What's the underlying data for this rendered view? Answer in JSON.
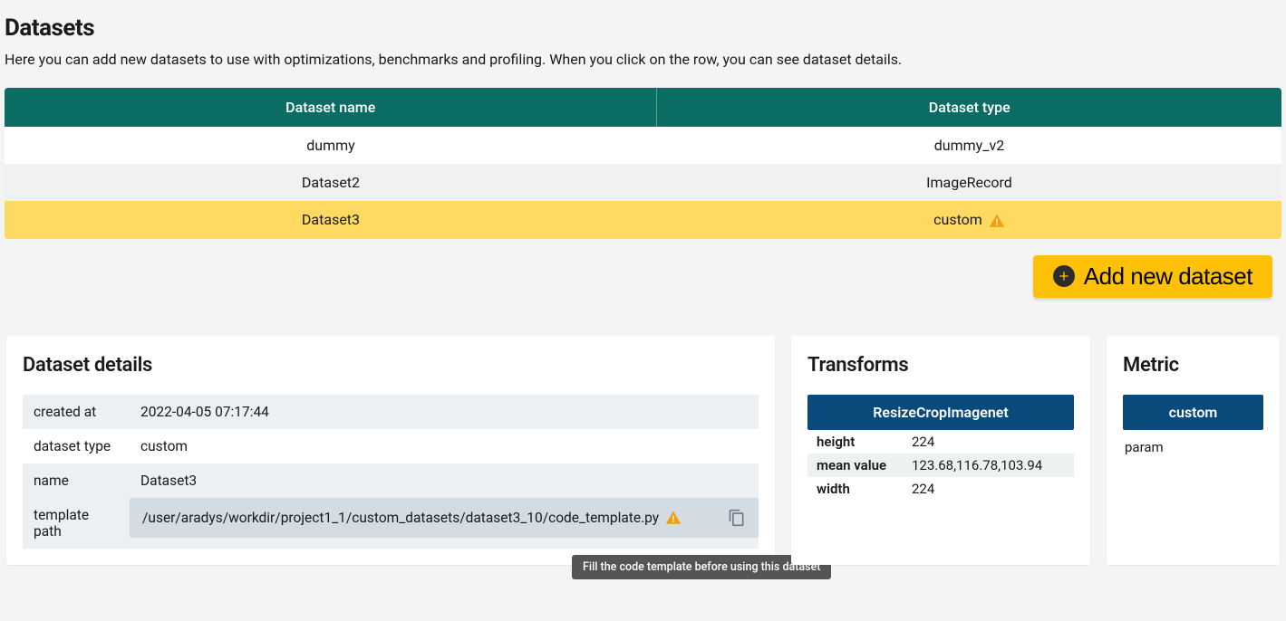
{
  "header": {
    "title": "Datasets",
    "description": "Here you can add new datasets to use with optimizations, benchmarks and profiling. When you click on the row, you can see dataset details."
  },
  "table": {
    "cols": [
      "Dataset name",
      "Dataset type"
    ],
    "rows": [
      {
        "name": "dummy",
        "type": "dummy_v2",
        "warn": false,
        "selected": false
      },
      {
        "name": "Dataset2",
        "type": "ImageRecord",
        "warn": false,
        "selected": false
      },
      {
        "name": "Dataset3",
        "type": "custom",
        "warn": true,
        "selected": true
      }
    ]
  },
  "add_button_label": "Add new dataset",
  "details": {
    "title": "Dataset details",
    "rows": [
      {
        "k": "created at",
        "v": "2022-04-05 07:17:44"
      },
      {
        "k": "dataset type",
        "v": "custom"
      },
      {
        "k": "name",
        "v": "Dataset3"
      }
    ],
    "template_path_label": "template path",
    "template_path_value": "/user/aradys/workdir/project1_1/custom_datasets/dataset3_10/code_template.py",
    "tooltip": "Fill the code template before using this dataset"
  },
  "transforms": {
    "title": "Transforms",
    "name": "ResizeCropImagenet",
    "params": [
      {
        "k": "height",
        "v": "224"
      },
      {
        "k": "mean value",
        "v": "123.68,116.78,103.94"
      },
      {
        "k": "width",
        "v": "224"
      }
    ]
  },
  "metric": {
    "title": "Metric",
    "name": "custom",
    "param_label": "param"
  }
}
